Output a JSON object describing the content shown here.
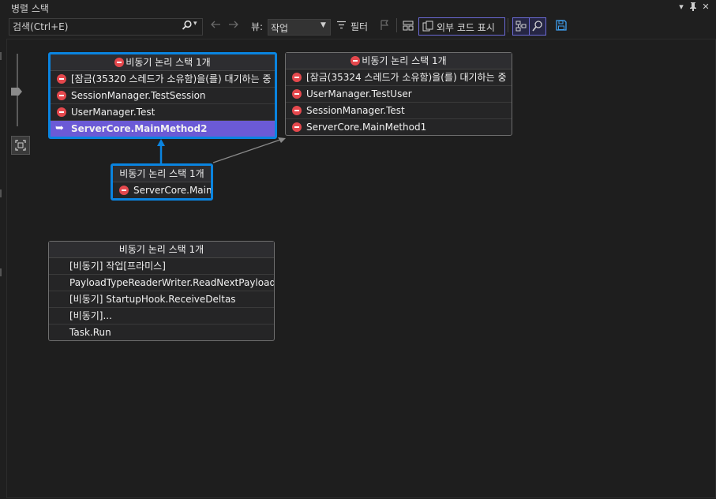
{
  "window": {
    "title": "병렬 스택"
  },
  "toolbar": {
    "search_placeholder": "검색(Ctrl+E)",
    "view_label": "뷰:",
    "view_value": "작업",
    "filter_label": "필터",
    "external_code_label": "외부 코드 표시"
  },
  "nodes": [
    {
      "header": "비동기 논리 스택 1개",
      "frames": [
        "[잠금(35320 스레드가 소유함)을(를) 대기하는 중",
        "SessionManager.TestSession",
        "UserManager.Test",
        "ServerCore.MainMethod2"
      ]
    },
    {
      "header": "비동기 논리 스택 1개",
      "frames": [
        "[잠금(35324 스레드가 소유함)을(를) 대기하는 중",
        "UserManager.TestUser",
        "SessionManager.Test",
        "ServerCore.MainMethod1"
      ]
    },
    {
      "header": "비동기 논리 스택 1개",
      "frames": [
        "ServerCore.Main"
      ]
    },
    {
      "header": "비동기 논리 스택 1개",
      "frames": [
        "[비동기] 작업[프라미스]",
        "PayloadTypeReaderWriter.ReadNextPayloadT...",
        "[비동기] StartupHook.ReceiveDeltas",
        "[비동기]...",
        "Task.Run"
      ]
    }
  ],
  "colors": {
    "active_border": "#0a84e0",
    "current_frame_bg": "#6b5ad6",
    "breakpoint": "#e5484d"
  },
  "icons": [
    "search-icon",
    "back-arrow-icon",
    "forward-arrow-icon",
    "filter-icon",
    "flag-icon",
    "layout-icon",
    "external-code-icon",
    "toggle-method-view-icon",
    "zoom-find-icon",
    "save-icon",
    "pin-icon",
    "close-icon",
    "dropdown-icon",
    "zoom-fit-icon"
  ]
}
